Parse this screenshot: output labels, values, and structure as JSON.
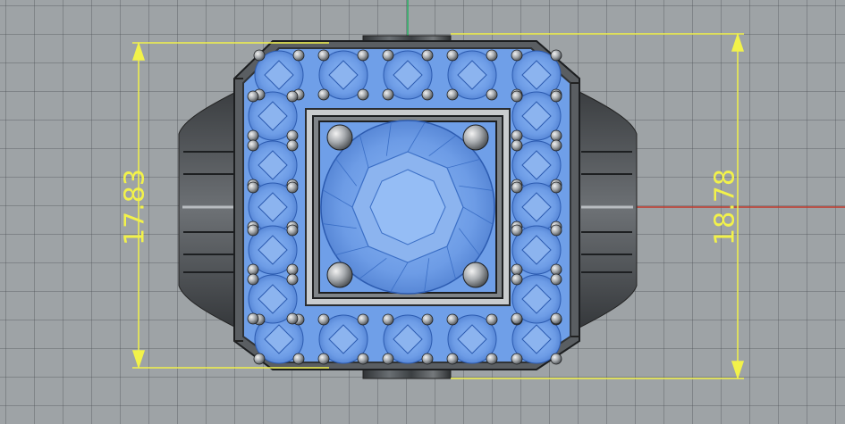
{
  "viewport": {
    "view_type": "Top",
    "colors": {
      "grid_bg": "#9ea3a6",
      "axis_x": "#c0392b",
      "axis_y": "#27ae60",
      "dimension": "#f2f24a",
      "gem": "#6f9fe8",
      "metal": "#505458"
    }
  },
  "dimensions": {
    "left_label": "17.83",
    "right_label": "18.78"
  },
  "model": {
    "name": "ring-top-view",
    "center_stone": "round-brilliant",
    "halo_stone_count": 20
  }
}
